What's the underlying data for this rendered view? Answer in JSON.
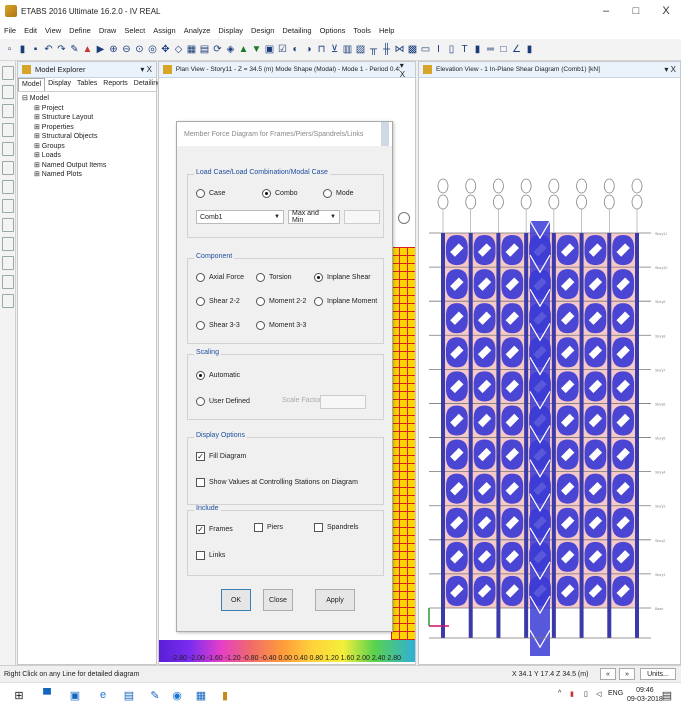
{
  "window": {
    "title": "ETABS 2016 Ultimate 16.2.0 - IV REAL",
    "minimize": "–",
    "maximize": "□",
    "close": "X"
  },
  "menu": [
    "File",
    "Edit",
    "View",
    "Define",
    "Draw",
    "Select",
    "Assign",
    "Analyze",
    "Display",
    "Design",
    "Detailing",
    "Options",
    "Tools",
    "Help"
  ],
  "explorer": {
    "title": "Model Explorer",
    "close": "▾ X",
    "tabs": [
      "Model",
      "Display",
      "Tables",
      "Reports",
      "Detailing"
    ],
    "tree": [
      {
        "label": "⊟ Model",
        "child": false
      },
      {
        "label": "⊞ Project",
        "child": true
      },
      {
        "label": "⊞ Structure Layout",
        "child": true
      },
      {
        "label": "⊞ Properties",
        "child": true
      },
      {
        "label": "⊞ Structural Objects",
        "child": true
      },
      {
        "label": "⊞ Groups",
        "child": true
      },
      {
        "label": "⊞ Loads",
        "child": true
      },
      {
        "label": "⊞ Named Output Items",
        "child": true
      },
      {
        "label": "⊞ Named Plots",
        "child": true
      }
    ]
  },
  "plan_view": {
    "title": "Plan View - Story11 - Z = 34.5 (m)  Mode Shape (Modal) - Mode 1 - Period 0.431",
    "close": "▾ X",
    "scale": "-2.80 -2.00 -1.60 -1.20 -0.80 -0.40 0.00 0.40 0.80 1.20 1.60 2.00 2.40 2.80"
  },
  "elevation_view": {
    "title": "Elevation View - 1   In-Plane Shear Diagram   (Comb1)  [kN]",
    "close": "▾ X",
    "story_labels": [
      "Story11",
      "Story10",
      "Story9",
      "Story8",
      "Story7",
      "Story6",
      "Story5",
      "Story4",
      "Story3",
      "Story2",
      "Story1",
      "Base"
    ]
  },
  "dialog": {
    "title": "Member Force Diagram for Frames/Piers/Spandrels/Links",
    "load_case": {
      "legend": "Load Case/Load Combination/Modal Case",
      "options": [
        "Case",
        "Combo",
        "Mode"
      ],
      "selected": "Combo",
      "combo_value": "Comb1",
      "envelope_value": "Max and Min"
    },
    "component": {
      "legend": "Component",
      "options": [
        "Axial Force",
        "Torsion",
        "Inplane Shear",
        "Shear 2-2",
        "Moment 2-2",
        "Inplane Moment",
        "Shear 3-3",
        "Moment 3-3"
      ],
      "selected": "Inplane Shear"
    },
    "scaling": {
      "legend": "Scaling",
      "options": [
        "Automatic",
        "User Defined"
      ],
      "selected": "Automatic",
      "scale_factor_label": "Scale Factor"
    },
    "display_options": {
      "legend": "Display Options",
      "fill_diagram": "Fill Diagram",
      "fill_checked": true,
      "show_values": "Show Values at Controlling Stations on Diagram",
      "show_values_checked": false
    },
    "include": {
      "legend": "Include",
      "frames": "Frames",
      "frames_checked": true,
      "piers": "Piers",
      "piers_checked": false,
      "spandrels": "Spandrels",
      "spandrels_checked": false,
      "links": "Links",
      "links_checked": false
    },
    "buttons": {
      "ok": "OK",
      "close": "Close",
      "apply": "Apply"
    }
  },
  "status": {
    "hint": "Right Click on any Line for detailed diagram",
    "coords": "X 34.1  Y 17.4  Z 34.5 (m)",
    "prev": "«",
    "next": "»",
    "units": "Units..."
  },
  "taskbar": {
    "lang": "ENG",
    "time": "09:46",
    "date": "09-03-2018"
  },
  "colors": {
    "diagram_fill": "#3b3bd4",
    "panel_fill": "#f6c9c9",
    "column_fill": "#3a3aa8"
  }
}
